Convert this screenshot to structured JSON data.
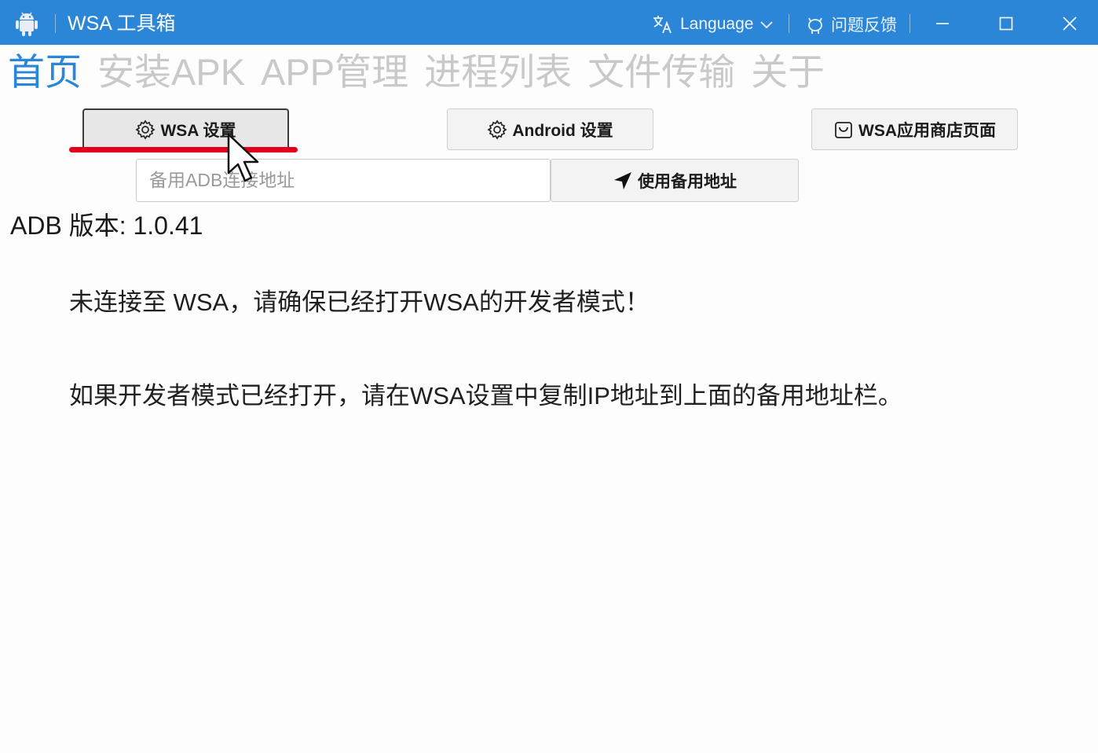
{
  "window": {
    "title": "WSA 工具箱",
    "language_label": "Language",
    "feedback_label": "问题反馈",
    "accent_color": "#2b86d8"
  },
  "tabs": [
    {
      "label": "首页",
      "active": true
    },
    {
      "label": "安装APK",
      "active": false
    },
    {
      "label": "APP管理",
      "active": false
    },
    {
      "label": "进程列表",
      "active": false
    },
    {
      "label": "文件传输",
      "active": false
    },
    {
      "label": "关于",
      "active": false
    }
  ],
  "actions": {
    "wsa_settings": "WSA 设置",
    "android_settings": "Android 设置",
    "wsa_store_page": "WSA应用商店页面",
    "use_backup_address": "使用备用地址"
  },
  "adb_input": {
    "placeholder": "备用ADB连接地址",
    "value": ""
  },
  "status": {
    "adb_version": "ADB 版本: 1.0.41",
    "message_1": "未连接至 WSA，请确保已经打开WSA的开发者模式！",
    "message_2": "如果开发者模式已经打开，请在WSA设置中复制IP地址到上面的备用地址栏。"
  },
  "icons": {
    "app": "android-icon",
    "language": "translate-icon",
    "feedback": "github-icon",
    "settings": "gear-icon",
    "store": "store-bag-icon",
    "send": "navigation-arrow-icon"
  }
}
